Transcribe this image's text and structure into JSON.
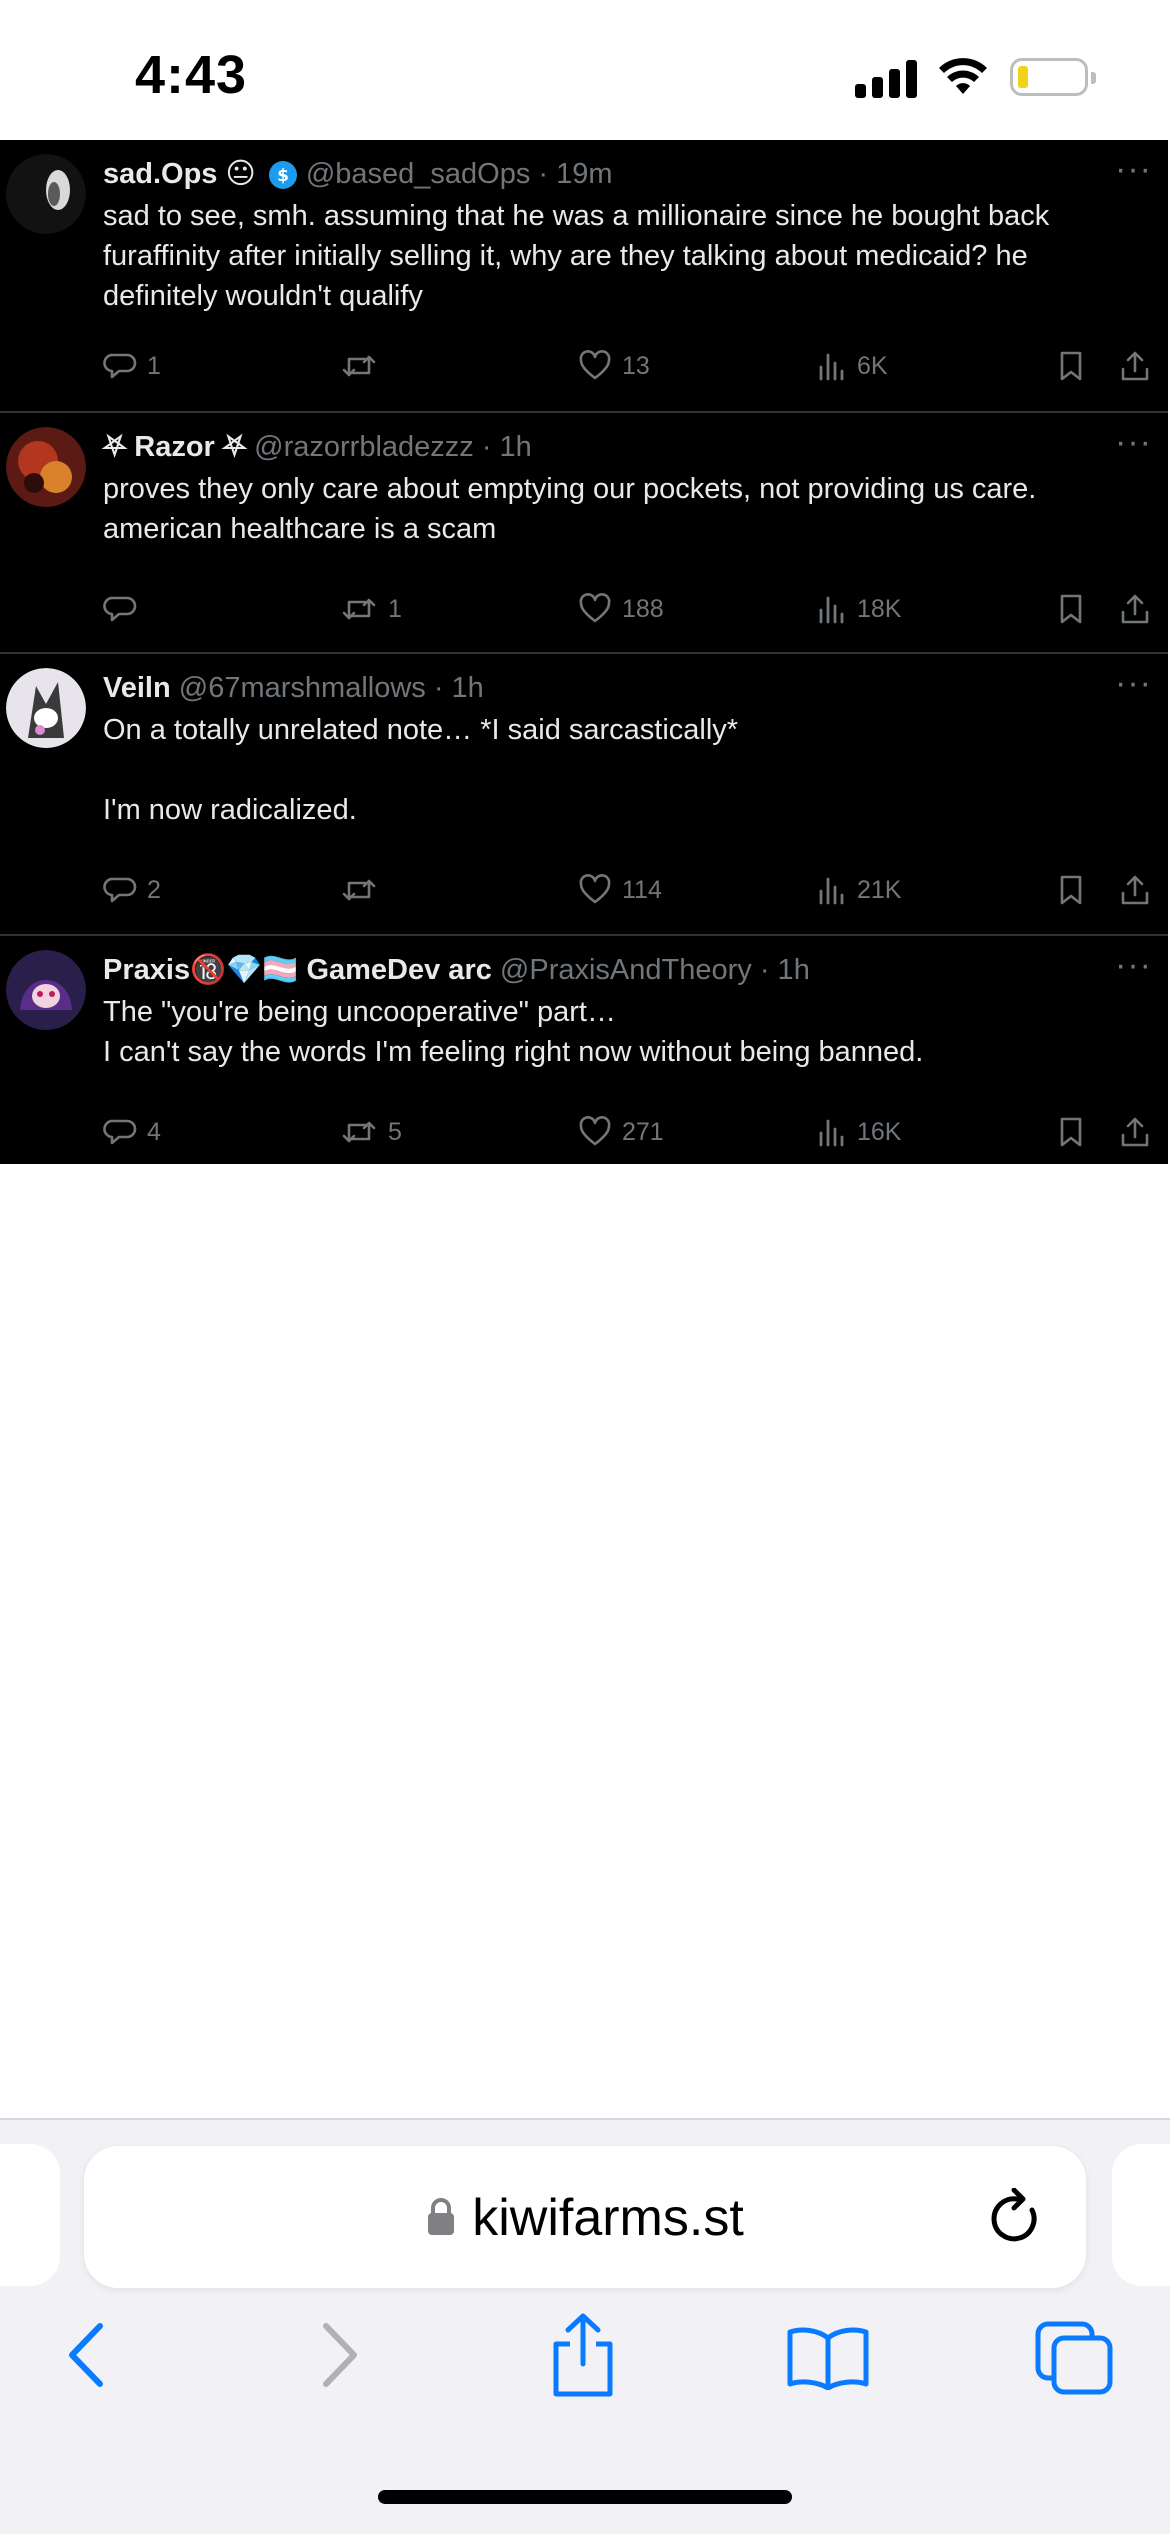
{
  "status_bar": {
    "time": "4:43"
  },
  "tweets": [
    {
      "name": "sad.Ops 😐",
      "handle_time": "@based_sadOps · 19m",
      "text": "sad to see, smh. assuming that he was a millionaire since he bought back furaffinity after initially selling it, why are they talking about medicaid? he definitely wouldn't qualify",
      "replies": "1",
      "retweets": "",
      "likes": "13",
      "views": "6K"
    },
    {
      "name": "⛧ Razor ⛧",
      "handle_time": "@razorrbladezzz · 1h",
      "text": "proves they only care about emptying our pockets, not providing us care. american healthcare is a scam",
      "replies": "",
      "retweets": "1",
      "likes": "188",
      "views": "18K"
    },
    {
      "name": "Veiln",
      "handle_time": "@67marshmallows · 1h",
      "text": "On a totally unrelated note… *I said sarcastically*\n\nI'm now radicalized.",
      "replies": "2",
      "retweets": "",
      "likes": "114",
      "views": "21K"
    },
    {
      "name": "Praxis🔞💎🏳️‍⚧️ GameDev arc",
      "handle_time": "@PraxisAndTheory · 1h",
      "text": "The \"you're being uncooperative\" part…\nI can't say the words I'm feeling right now without being banned.",
      "replies": "4",
      "retweets": "5",
      "likes": "271",
      "views": "16K"
    }
  ],
  "browser": {
    "url": "kiwifarms.st"
  },
  "colors": {
    "tweet_bg": "#000000",
    "text": "#e7e9ea",
    "muted": "#71767b",
    "safari_blue": "#0a7aff"
  }
}
